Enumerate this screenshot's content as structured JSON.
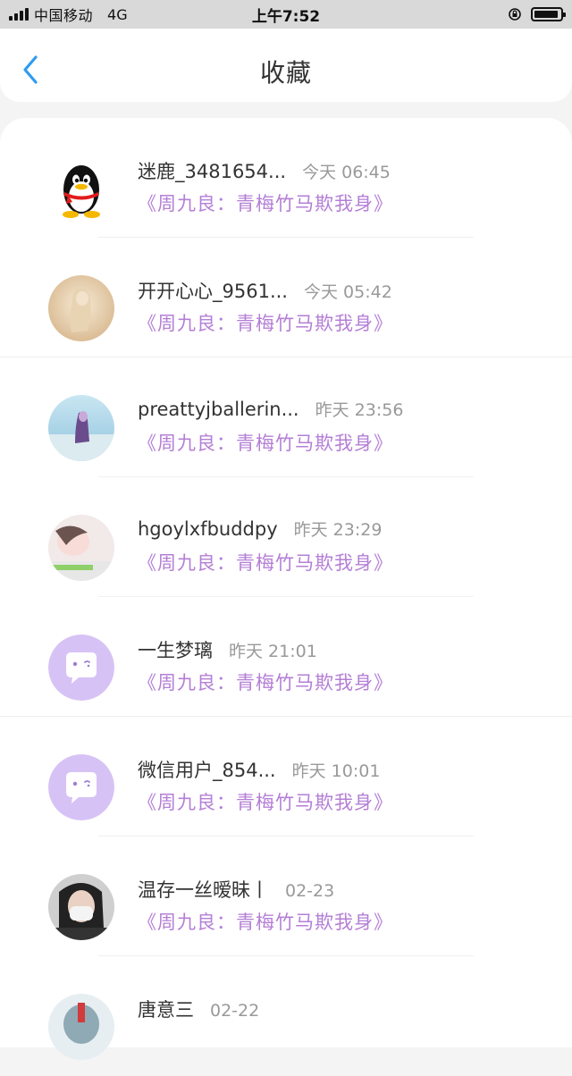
{
  "status_bar": {
    "carrier": "中国移动",
    "network": "4G",
    "time": "上午7:52"
  },
  "nav": {
    "title": "收藏"
  },
  "items": [
    {
      "username": "迷鹿_3481654...",
      "time": "今天 06:45",
      "title": "《周九良：青梅竹马欺我身》",
      "avatar": "qq-penguin-icon"
    },
    {
      "username": "开开心心_9561...",
      "time": "今天 05:42",
      "title": "《周九良：青梅竹马欺我身》",
      "avatar": "photo-avatar"
    },
    {
      "username": "preattyjballerin...",
      "time": "昨天 23:56",
      "title": "《周九良：青梅竹马欺我身》",
      "avatar": "photo-avatar"
    },
    {
      "username": "hgoylxfbuddpy",
      "time": "昨天 23:29",
      "title": "《周九良：青梅竹马欺我身》",
      "avatar": "photo-avatar"
    },
    {
      "username": "一生梦璃",
      "time": "昨天 21:01",
      "title": "《周九良：青梅竹马欺我身》",
      "avatar": "default-chat-avatar-icon"
    },
    {
      "username": "微信用户_854...",
      "time": "昨天 10:01",
      "title": "《周九良：青梅竹马欺我身》",
      "avatar": "default-chat-avatar-icon"
    },
    {
      "username": "温存一丝暧昧丨",
      "time": "02-23",
      "title": "《周九良：青梅竹马欺我身》",
      "avatar": "photo-avatar"
    },
    {
      "username": "唐意三",
      "time": "02-22",
      "title": "",
      "avatar": "photo-avatar"
    }
  ],
  "colors": {
    "accent_blue": "#2f9cf0",
    "title_purple": "#b47fd6",
    "default_avatar_purple": "#d7c2f5"
  }
}
